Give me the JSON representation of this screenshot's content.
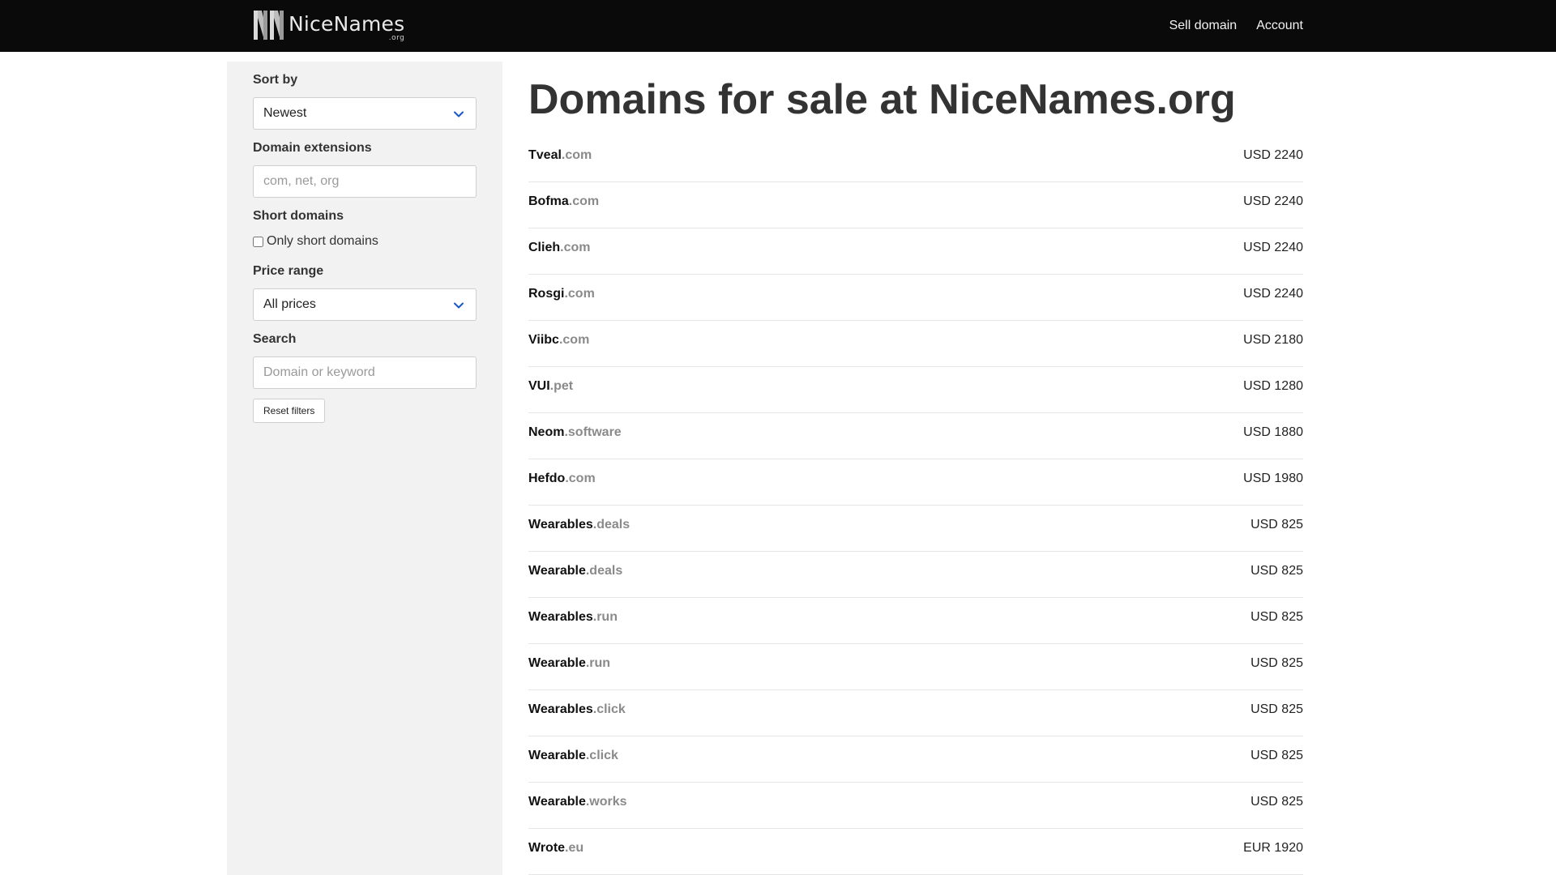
{
  "header": {
    "logo_text": "NiceNames",
    "logo_tld": ".org",
    "nav": [
      {
        "label": "Sell domain"
      },
      {
        "label": "Account"
      }
    ]
  },
  "sidebar": {
    "sort_label": "Sort by",
    "sort_value": "Newest",
    "extensions_label": "Domain extensions",
    "extensions_placeholder": "com, net, org",
    "short_label": "Short domains",
    "short_checkbox_label": "Only short domains",
    "short_checked": false,
    "price_label": "Price range",
    "price_value": "All prices",
    "search_label": "Search",
    "search_placeholder": "Domain or keyword",
    "reset_label": "Reset filters"
  },
  "main": {
    "title": "Domains for sale at NiceNames.org",
    "domains": [
      {
        "base": "Tveal",
        "ext": ".com",
        "price": "USD 2240"
      },
      {
        "base": "Bofma",
        "ext": ".com",
        "price": "USD 2240"
      },
      {
        "base": "Clieh",
        "ext": ".com",
        "price": "USD 2240"
      },
      {
        "base": "Rosgi",
        "ext": ".com",
        "price": "USD 2240"
      },
      {
        "base": "Viibc",
        "ext": ".com",
        "price": "USD 2180"
      },
      {
        "base": "VUI",
        "ext": ".pet",
        "price": "USD 1280"
      },
      {
        "base": "Neom",
        "ext": ".software",
        "price": "USD 1880"
      },
      {
        "base": "Hefdo",
        "ext": ".com",
        "price": "USD 1980"
      },
      {
        "base": "Wearables",
        "ext": ".deals",
        "price": "USD 825"
      },
      {
        "base": "Wearable",
        "ext": ".deals",
        "price": "USD 825"
      },
      {
        "base": "Wearables",
        "ext": ".run",
        "price": "USD 825"
      },
      {
        "base": "Wearable",
        "ext": ".run",
        "price": "USD 825"
      },
      {
        "base": "Wearables",
        "ext": ".click",
        "price": "USD 825"
      },
      {
        "base": "Wearable",
        "ext": ".click",
        "price": "USD 825"
      },
      {
        "base": "Wearable",
        "ext": ".works",
        "price": "USD 825"
      },
      {
        "base": "Wrote",
        "ext": ".eu",
        "price": "EUR 1920"
      }
    ]
  },
  "colors": {
    "topbar": "#0a0a0a",
    "sidebar": "#f2f2f2",
    "chevron": "#1a56c4",
    "extension_text": "#8a8a8a"
  },
  "icons": {
    "logo": "nn-monogram-icon",
    "select_arrow": "chevron-down-icon"
  }
}
